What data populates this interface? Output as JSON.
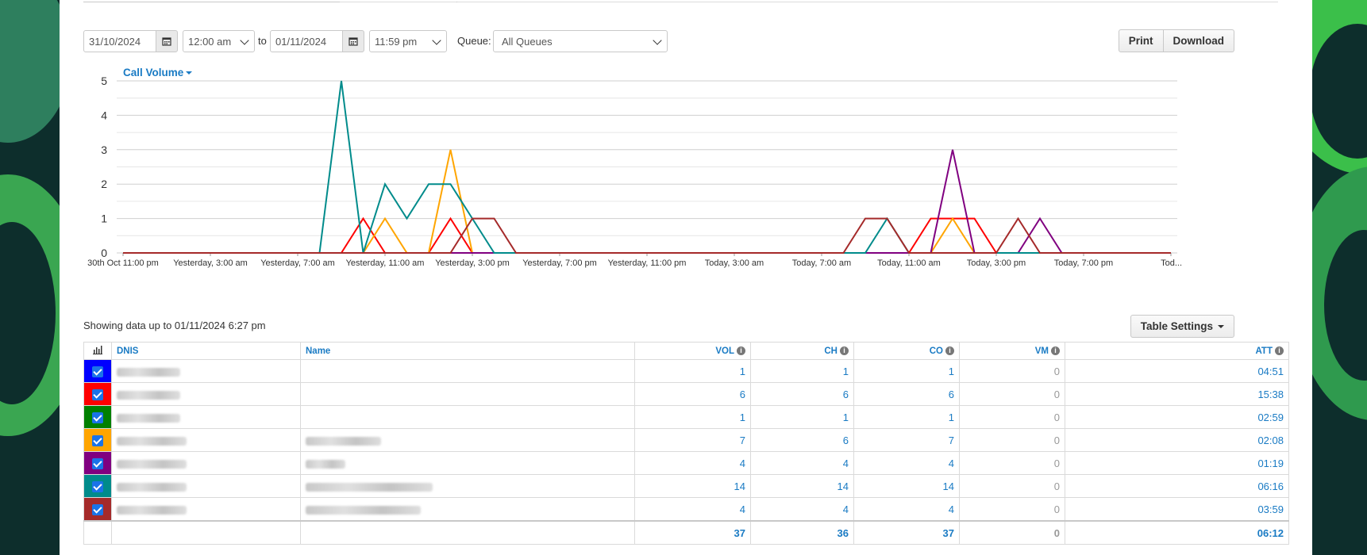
{
  "controls": {
    "start_date": "31/10/2024",
    "start_time": "12:00 am",
    "to_label": "to",
    "end_date": "01/11/2024",
    "end_time": "11:59 pm",
    "queue_label": "Queue:",
    "queue_value": "All Queues",
    "print_label": "Print",
    "download_label": "Download"
  },
  "chart_menu_label": "Call Volume",
  "chart_data": {
    "type": "line",
    "x": [
      "30th Oct 11:00 pm",
      "Yesterday, 3:00 am",
      "Yesterday, 7:00 am",
      "Yesterday, 11:00 am",
      "Yesterday, 3:00 pm",
      "Yesterday, 7:00 pm",
      "Yesterday, 11:00 pm",
      "Today, 3:00 am",
      "Today, 7:00 am",
      "Today, 11:00 am",
      "Today, 3:00 pm",
      "Today, 7:00 pm",
      "Tod..."
    ],
    "x_hours": [
      0,
      1,
      2,
      3,
      4,
      5,
      6,
      7,
      8,
      9,
      10,
      11,
      12,
      13,
      14,
      15,
      16,
      17,
      18,
      19,
      20,
      21,
      22,
      23,
      24,
      25,
      26,
      27,
      28,
      29,
      30,
      31,
      32,
      33,
      34,
      35,
      36,
      37,
      38,
      39,
      40,
      41,
      42,
      43,
      44,
      45,
      46,
      47,
      48
    ],
    "ylim": [
      0,
      5
    ],
    "yticks": [
      0,
      1,
      2,
      3,
      4,
      5
    ],
    "grid": true,
    "series": [
      {
        "color": "#0000ff",
        "points": []
      },
      {
        "color": "#ff0000",
        "points": [
          [
            11,
            1
          ],
          [
            15,
            1
          ],
          [
            37,
            1
          ],
          [
            38,
            1
          ],
          [
            39,
            1
          ]
        ]
      },
      {
        "color": "#008000",
        "points": []
      },
      {
        "color": "#ffa500",
        "points": [
          [
            12,
            1
          ],
          [
            15,
            3
          ],
          [
            38,
            1
          ]
        ]
      },
      {
        "color": "#800080",
        "points": [
          [
            38,
            3
          ],
          [
            42,
            1
          ]
        ]
      },
      {
        "color": "#008b8b",
        "points": [
          [
            10,
            5
          ],
          [
            12,
            2
          ],
          [
            13,
            1
          ],
          [
            14,
            2
          ],
          [
            15,
            2
          ],
          [
            16,
            1
          ],
          [
            35,
            1
          ]
        ]
      },
      {
        "color": "#a52a2a",
        "points": [
          [
            16,
            1
          ],
          [
            17,
            1
          ],
          [
            34,
            1
          ],
          [
            35,
            1
          ],
          [
            41,
            1
          ]
        ]
      }
    ]
  },
  "status_text": "Showing data up to 01/11/2024 6:27 pm",
  "table_settings_label": "Table Settings",
  "table": {
    "headers": {
      "dnis": "DNIS",
      "name": "Name",
      "vol": "VOL",
      "ch": "CH",
      "co": "CO",
      "vm": "VM",
      "att": "ATT"
    },
    "rows": [
      {
        "color": "#0000ff",
        "vol": "1",
        "ch": "1",
        "co": "1",
        "vm": "0",
        "att": "04:51"
      },
      {
        "color": "#ff0000",
        "vol": "6",
        "ch": "6",
        "co": "6",
        "vm": "0",
        "att": "15:38"
      },
      {
        "color": "#008000",
        "vol": "1",
        "ch": "1",
        "co": "1",
        "vm": "0",
        "att": "02:59"
      },
      {
        "color": "#ffa500",
        "vol": "7",
        "ch": "6",
        "co": "7",
        "vm": "0",
        "att": "02:08"
      },
      {
        "color": "#800080",
        "vol": "4",
        "ch": "4",
        "co": "4",
        "vm": "0",
        "att": "01:19"
      },
      {
        "color": "#008b8b",
        "vol": "14",
        "ch": "14",
        "co": "14",
        "vm": "0",
        "att": "06:16"
      },
      {
        "color": "#a52a2a",
        "vol": "4",
        "ch": "4",
        "co": "4",
        "vm": "0",
        "att": "03:59"
      }
    ],
    "totals": {
      "vol": "37",
      "ch": "36",
      "co": "37",
      "vm": "0",
      "att": "06:12"
    }
  }
}
